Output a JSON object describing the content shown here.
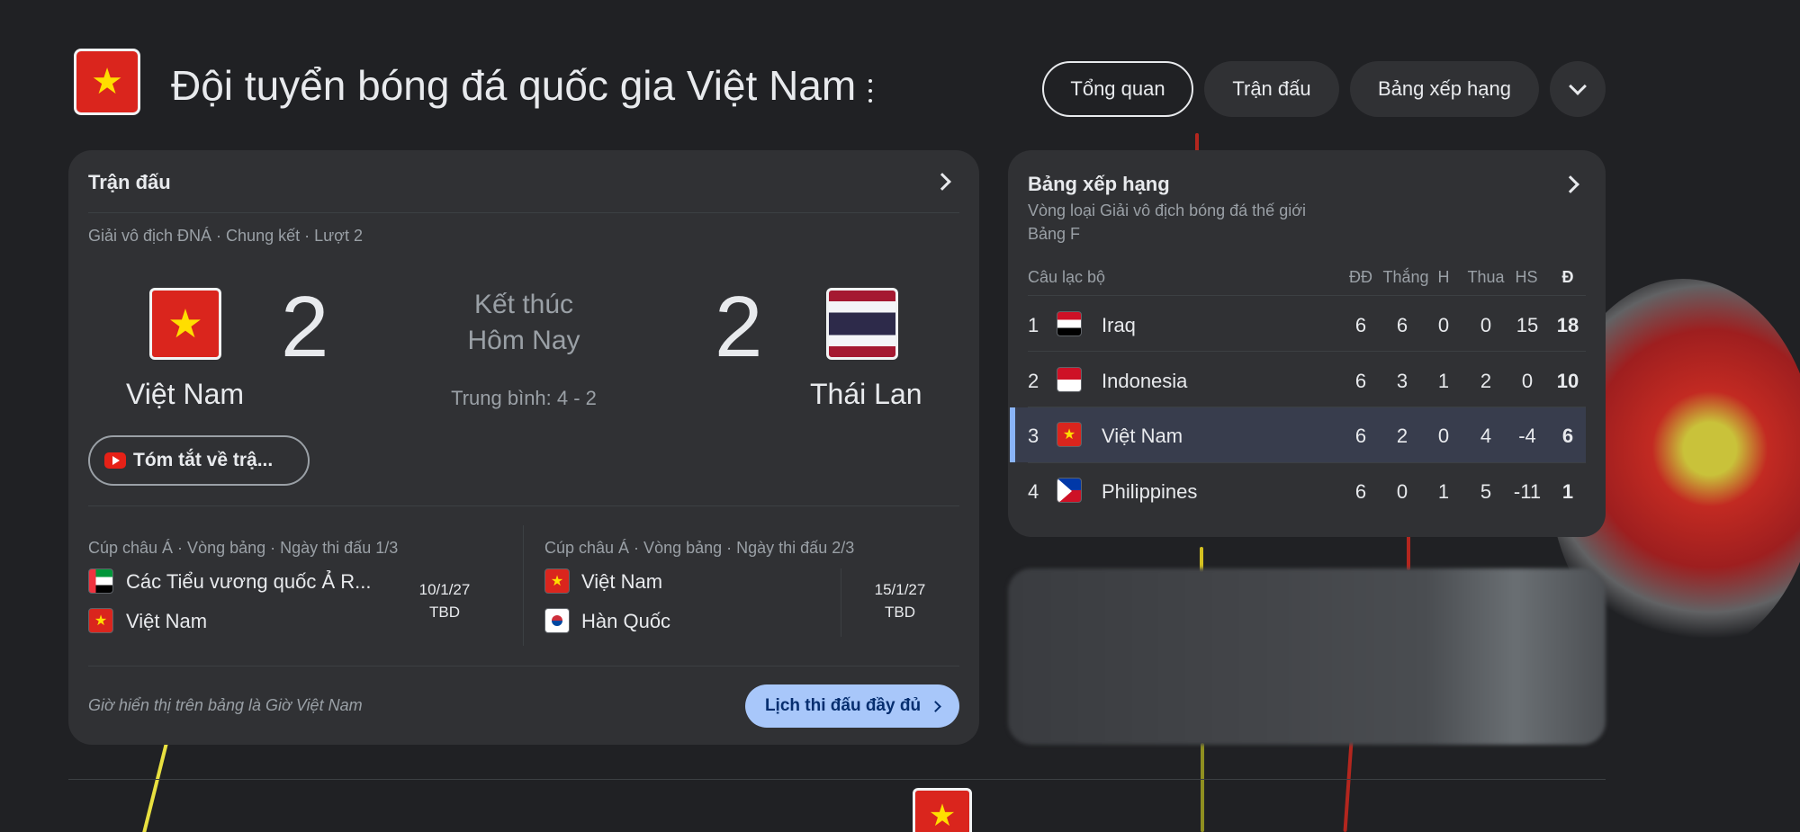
{
  "header": {
    "title": "Đội tuyển bóng đá quốc gia Việt Nam",
    "tabs": [
      {
        "label": "Tổng quan",
        "active": true
      },
      {
        "label": "Trận đấu",
        "active": false
      },
      {
        "label": "Bảng xếp hạng",
        "active": false
      }
    ],
    "more_icon": "chevron-down-icon",
    "logo_icon": "star-icon"
  },
  "match_card": {
    "title": "Trận đấu",
    "competition": "Giải vô địch ĐNÁ · Chung kết · Lượt 2",
    "home": {
      "name": "Việt Nam",
      "score": "2"
    },
    "away": {
      "name": "Thái Lan",
      "score": "2"
    },
    "status_line1": "Kết thúc",
    "status_line2": "Hôm Nay",
    "aggregate": "Trung bình: 4 - 2",
    "summary_button": "Tóm tắt về trậ...",
    "fixtures": [
      {
        "meta": "Cúp châu Á · Vòng bảng · Ngày thi đấu 1/3",
        "team1": "Các Tiểu vương quốc Ả R...",
        "team2": "Việt Nam",
        "date": "10/1/27",
        "time": "TBD"
      },
      {
        "meta": "Cúp châu Á · Vòng bảng · Ngày thi đấu 2/3",
        "team1": "Việt Nam",
        "team2": "Hàn Quốc",
        "date": "15/1/27",
        "time": "TBD"
      }
    ],
    "footer_note": "Giờ hiển thị trên bảng là Giờ Việt Nam",
    "full_schedule_button": "Lịch thi đấu đầy đủ"
  },
  "standings": {
    "title": "Bảng xếp hạng",
    "subtitle1": "Vòng loại Giải vô địch bóng đá thế giới",
    "subtitle2": "Bảng F",
    "headers": {
      "club": "Câu lạc bộ",
      "played": "ĐĐ",
      "won": "Thắng",
      "draw": "H",
      "lost": "Thua",
      "gd": "HS",
      "pts": "Đ"
    },
    "rows": [
      {
        "rank": "1",
        "team": "Iraq",
        "played": "6",
        "won": "6",
        "draw": "0",
        "lost": "0",
        "gd": "15",
        "pts": "18",
        "highlight": false
      },
      {
        "rank": "2",
        "team": "Indonesia",
        "played": "6",
        "won": "3",
        "draw": "1",
        "lost": "2",
        "gd": "0",
        "pts": "10",
        "highlight": false
      },
      {
        "rank": "3",
        "team": "Việt Nam",
        "played": "6",
        "won": "2",
        "draw": "0",
        "lost": "4",
        "gd": "-4",
        "pts": "6",
        "highlight": true
      },
      {
        "rank": "4",
        "team": "Philippines",
        "played": "6",
        "won": "0",
        "draw": "1",
        "lost": "5",
        "gd": "-11",
        "pts": "1",
        "highlight": false
      }
    ]
  },
  "colors": {
    "background": "#202124",
    "card": "#303134",
    "accent_button": "#a8c7fa",
    "highlight_row": "#383d4d",
    "vn_red": "#da251d",
    "vn_star": "#ffde00"
  }
}
